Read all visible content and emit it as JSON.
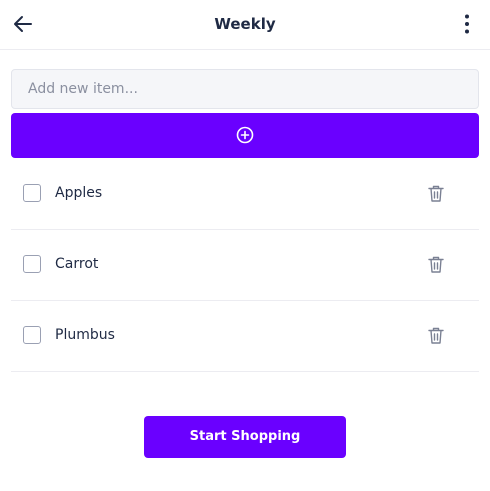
{
  "header": {
    "title": "Weekly",
    "back_icon": "arrow-left-icon",
    "menu_icon": "more-vertical-icon"
  },
  "add_item": {
    "placeholder": "Add new item...",
    "value": "",
    "button_icon": "plus-circle-icon"
  },
  "items": [
    {
      "label": "Apples",
      "checked": false
    },
    {
      "label": "Carrot",
      "checked": false
    },
    {
      "label": "Plumbus",
      "checked": false
    }
  ],
  "start_button": {
    "label": "Start Shopping"
  },
  "colors": {
    "accent": "#6a00ff",
    "text": "#1f2a44",
    "muted": "#8b90a0",
    "divider": "#ececf1"
  }
}
